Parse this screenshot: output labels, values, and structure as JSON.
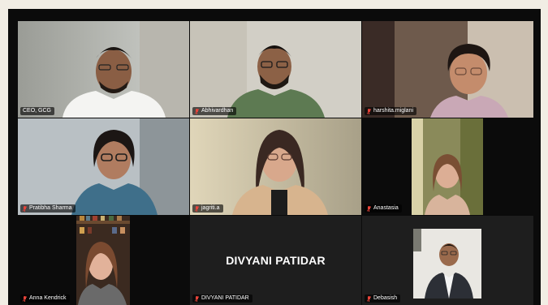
{
  "meeting": {
    "participants": [
      {
        "id": "ceo",
        "label": "CEO, GCG",
        "muted": false
      },
      {
        "id": "abhivardhan",
        "label": "Abhivardhan",
        "muted": true
      },
      {
        "id": "harshita",
        "label": "harshita.miglani",
        "muted": true
      },
      {
        "id": "pratibha",
        "label": "Pratibha Sharma",
        "muted": true
      },
      {
        "id": "jagriti",
        "label": "jagriti.a",
        "muted": true
      },
      {
        "id": "anastasia",
        "label": "Anastasia",
        "muted": true
      },
      {
        "id": "anna",
        "label": "Anna Kendrick",
        "muted": true
      },
      {
        "id": "divyani",
        "label": "DIVYANI PATIDAR",
        "muted": true,
        "display_name": "DIVYANI PATIDAR"
      },
      {
        "id": "debasish",
        "label": "Debasish",
        "muted": true
      }
    ]
  },
  "colors": {
    "active_speaker_border": "#e6e28a",
    "muted_icon": "#e8443a",
    "stage_background": "#0b0b0b",
    "page_background": "#f1ede4"
  }
}
